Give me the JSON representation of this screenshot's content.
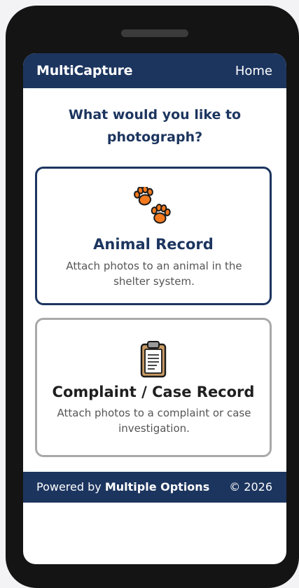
{
  "colors": {
    "navy": "#1c355f",
    "paw_orange": "#f47a1f",
    "card_border_secondary": "#a9a9a9"
  },
  "header": {
    "app_title": "MultiCapture",
    "home_label": "Home"
  },
  "prompt": {
    "question": "What would you like to photograph?"
  },
  "options": [
    {
      "icon": "paw-prints-icon",
      "title": "Animal Record",
      "description": "Attach photos to an animal in the shelter system."
    },
    {
      "icon": "clipboard-icon",
      "title": "Complaint / Case Record",
      "description": "Attach photos to a complaint or case investigation."
    }
  ],
  "footer": {
    "powered_prefix": "Powered by",
    "brand": "Multiple Options",
    "copyright": "© 2026"
  }
}
